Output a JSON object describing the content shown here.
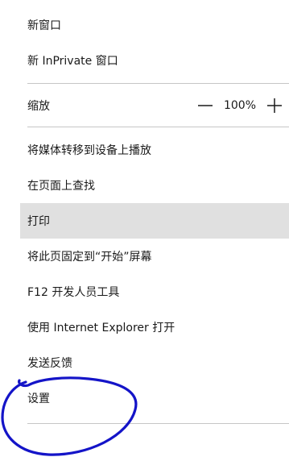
{
  "menu": {
    "new_window": "新窗口",
    "new_inprivate_window": "新 InPrivate 窗口",
    "zoom": {
      "label": "缩放",
      "value": "100%",
      "decrease_icon": "minus-icon",
      "increase_icon": "plus-icon"
    },
    "cast_media": "将媒体转移到设备上播放",
    "find_on_page": "在页面上查找",
    "print": "打印",
    "pin_to_start": "将此页固定到“开始”屏幕",
    "dev_tools": "F12 开发人员工具",
    "open_with_ie": "使用 Internet Explorer 打开",
    "send_feedback": "发送反馈",
    "settings": "设置"
  },
  "colors": {
    "hover_bg": "#e0e0e0",
    "divider": "#c6c6c6",
    "annotation_stroke": "#1414c8"
  }
}
